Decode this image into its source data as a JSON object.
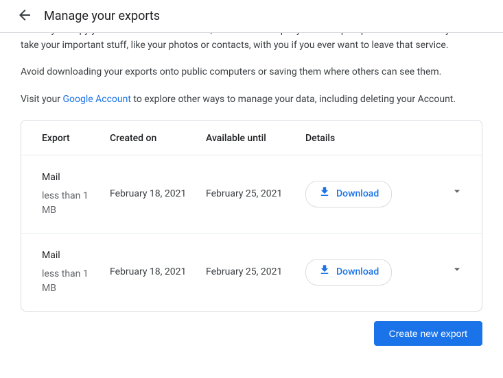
{
  "header": {
    "title": "Manage your exports"
  },
  "intro": {
    "p1": "Before you copy your data to another service, check that company's data export policies. Make sure you can take your important stuff, like your photos or contacts, with you if you ever want to leave that service.",
    "p2": "Avoid downloading your exports onto public computers or saving them where others can see them.",
    "p3_pre": "Visit your ",
    "p3_link": "Google Account",
    "p3_post": " to explore other ways to manage your data, including deleting your Account."
  },
  "table": {
    "headers": {
      "export": "Export",
      "created": "Created on",
      "available": "Available until",
      "details": "Details"
    },
    "download_label": "Download",
    "rows": [
      {
        "name": "Mail",
        "size": "less than 1 MB",
        "created": "February 18, 2021",
        "available": "February 25, 2021"
      },
      {
        "name": "Mail",
        "size": "less than 1 MB",
        "created": "February 18, 2021",
        "available": "February 25, 2021"
      }
    ]
  },
  "actions": {
    "create_new": "Create new export"
  }
}
